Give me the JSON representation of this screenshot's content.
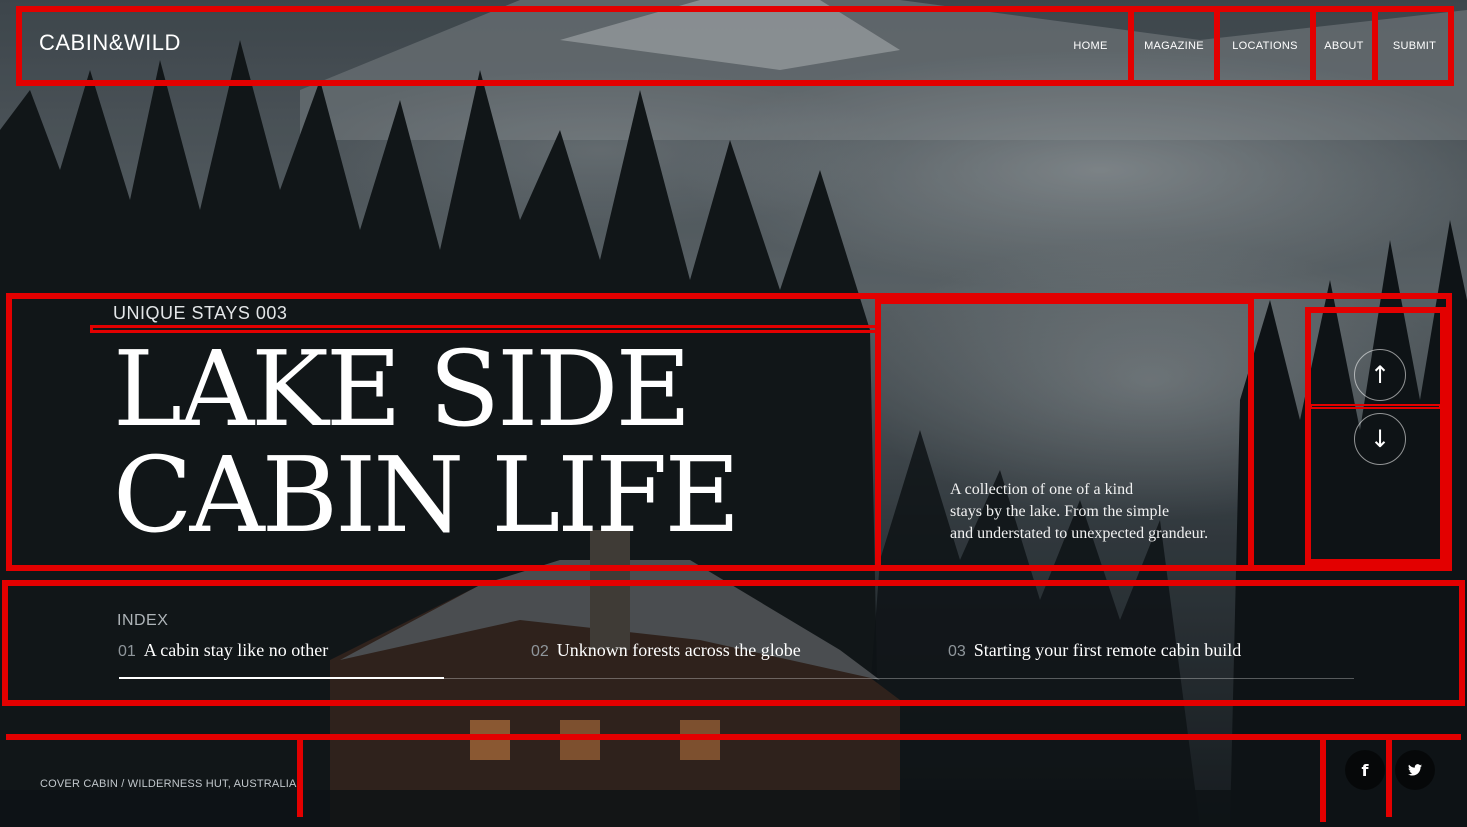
{
  "header": {
    "logo": "CABIN&WILD",
    "nav": [
      {
        "label": "HOME"
      },
      {
        "label": "MAGAZINE"
      },
      {
        "label": "LOCATIONS"
      },
      {
        "label": "ABOUT"
      },
      {
        "label": "SUBMIT"
      }
    ]
  },
  "hero": {
    "kicker": "UNIQUE STAYS 003",
    "title_line1": "LAKE SIDE",
    "title_line2": "CABIN LIFE",
    "description_line1": "A collection of one of a kind",
    "description_line2": "stays by the lake. From the simple",
    "description_line3": "and understated to unexpected grandeur.",
    "prev_icon": "arrow-up-icon",
    "next_icon": "arrow-down-icon"
  },
  "index": {
    "label": "INDEX",
    "items": [
      {
        "num": "01",
        "title": "A cabin stay like no other"
      },
      {
        "num": "02",
        "title": "Unknown forests across the globe"
      },
      {
        "num": "03",
        "title": "Starting your first remote cabin build"
      }
    ],
    "active_item": 1,
    "progress_fraction": 0.263
  },
  "footer": {
    "caption": "COVER CABIN /  WILDERNESS HUT, AUSTRALIA",
    "social": [
      {
        "icon": "facebook-icon",
        "glyph": "f"
      },
      {
        "icon": "twitter-icon",
        "glyph": "t"
      }
    ]
  },
  "colors": {
    "outline": "#e30000",
    "sky": "#59656c",
    "forest": "#141a1d"
  }
}
